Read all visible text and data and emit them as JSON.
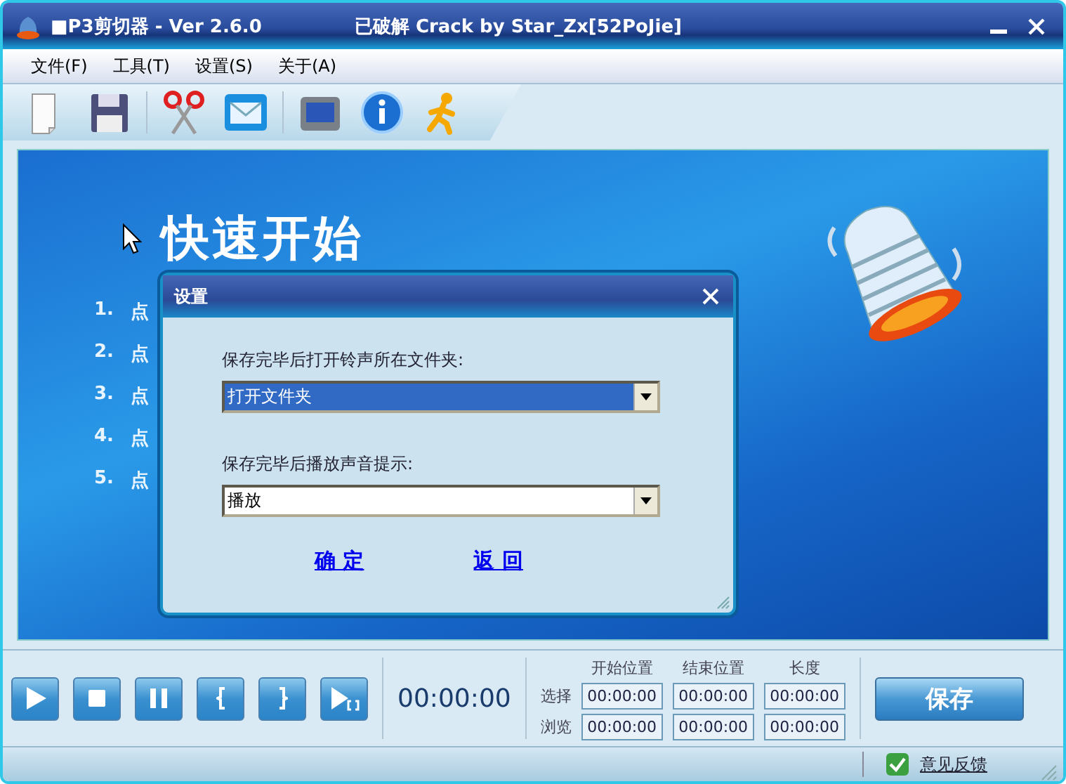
{
  "window": {
    "title": "■P3剪切器 - Ver 2.6.0",
    "subtitle": "已破解 Crack by Star_Zx[52PoJie]"
  },
  "menu": [
    "文件(F)",
    "工具(T)",
    "设置(S)",
    "关于(A)"
  ],
  "main": {
    "heading": "快速开始",
    "steps": [
      {
        "number": "1.",
        "text": "点"
      },
      {
        "number": "2.",
        "text": "点"
      },
      {
        "number": "3.",
        "text": "点"
      },
      {
        "number": "4.",
        "text": "点"
      },
      {
        "number": "5.",
        "text": "点"
      }
    ]
  },
  "dialog": {
    "title": "设置",
    "fields": [
      {
        "label": "保存完毕后打开铃声所在文件夹:",
        "value": "打开文件夹",
        "focused": true
      },
      {
        "label": "保存完毕后播放声音提示:",
        "value": "播放",
        "focused": false
      }
    ],
    "links": [
      "确 定",
      "返 回"
    ]
  },
  "controls": {
    "time": "00:00:00",
    "columns": [
      "开始位置",
      "结束位置",
      "长度"
    ],
    "rows": [
      {
        "label": "选择",
        "values": [
          "00:00:00",
          "00:00:00",
          "00:00:00"
        ]
      },
      {
        "label": "浏览",
        "values": [
          "00:00:00",
          "00:00:00",
          "00:00:00"
        ]
      }
    ],
    "save": "保存"
  },
  "status_bar": {
    "feedback": "意见反馈"
  }
}
